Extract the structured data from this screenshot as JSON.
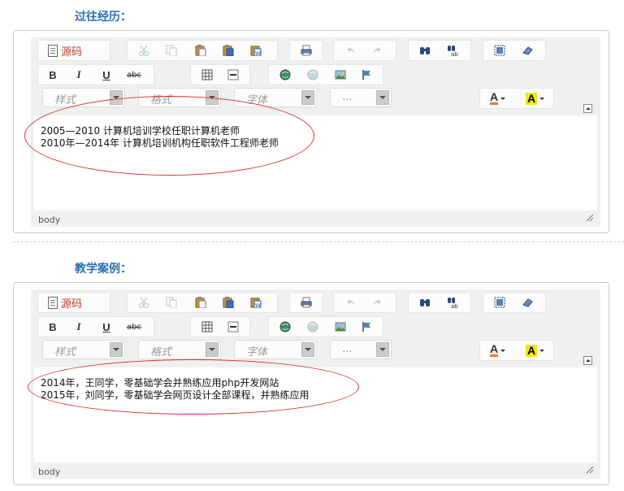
{
  "sections": [
    {
      "title": "过往经历：",
      "source_label": "源码",
      "style_placeholder": "样式",
      "format_placeholder": "格式",
      "font_placeholder": "字体",
      "size_placeholder": "...",
      "content": [
        "2005—2010  计算机培训学校任职计算机老师",
        "2010年—2014年 计算机培训机构任职软件工程师老师"
      ],
      "path": "body"
    },
    {
      "title": "教学案例：",
      "source_label": "源码",
      "style_placeholder": "样式",
      "format_placeholder": "格式",
      "font_placeholder": "字体",
      "size_placeholder": "...",
      "content": [
        "2014年，王同学，零基础学会并熟练应用php开发网站",
        "2015年，刘同学，零基础学会网页设计全部课程，并熟练应用"
      ],
      "path": "body"
    }
  ],
  "format_buttons": {
    "bold": "B",
    "italic": "I",
    "underline": "U",
    "strike": "abc"
  },
  "color_buttons": {
    "text_color": "A",
    "bg_color": "A"
  },
  "icons": [
    "document-icon",
    "cut-icon",
    "copy-icon",
    "paste-icon",
    "paste-text-icon",
    "paste-word-icon",
    "print-icon",
    "undo-icon",
    "redo-icon",
    "find-icon",
    "replace-icon",
    "select-all-icon",
    "remove-format-icon",
    "table-icon",
    "horizontal-rule-icon",
    "link-icon",
    "unlink-icon",
    "image-icon",
    "anchor-icon",
    "text-color-icon",
    "background-color-icon",
    "collapse-toolbar-icon",
    "resize-grip-icon"
  ],
  "colors": {
    "title": "#2a6fb5",
    "annotation": "#d9312b",
    "source_label": "#c0392b",
    "text_color_bar": "#e67e22",
    "bg_color_fill": "#f5e31a"
  }
}
